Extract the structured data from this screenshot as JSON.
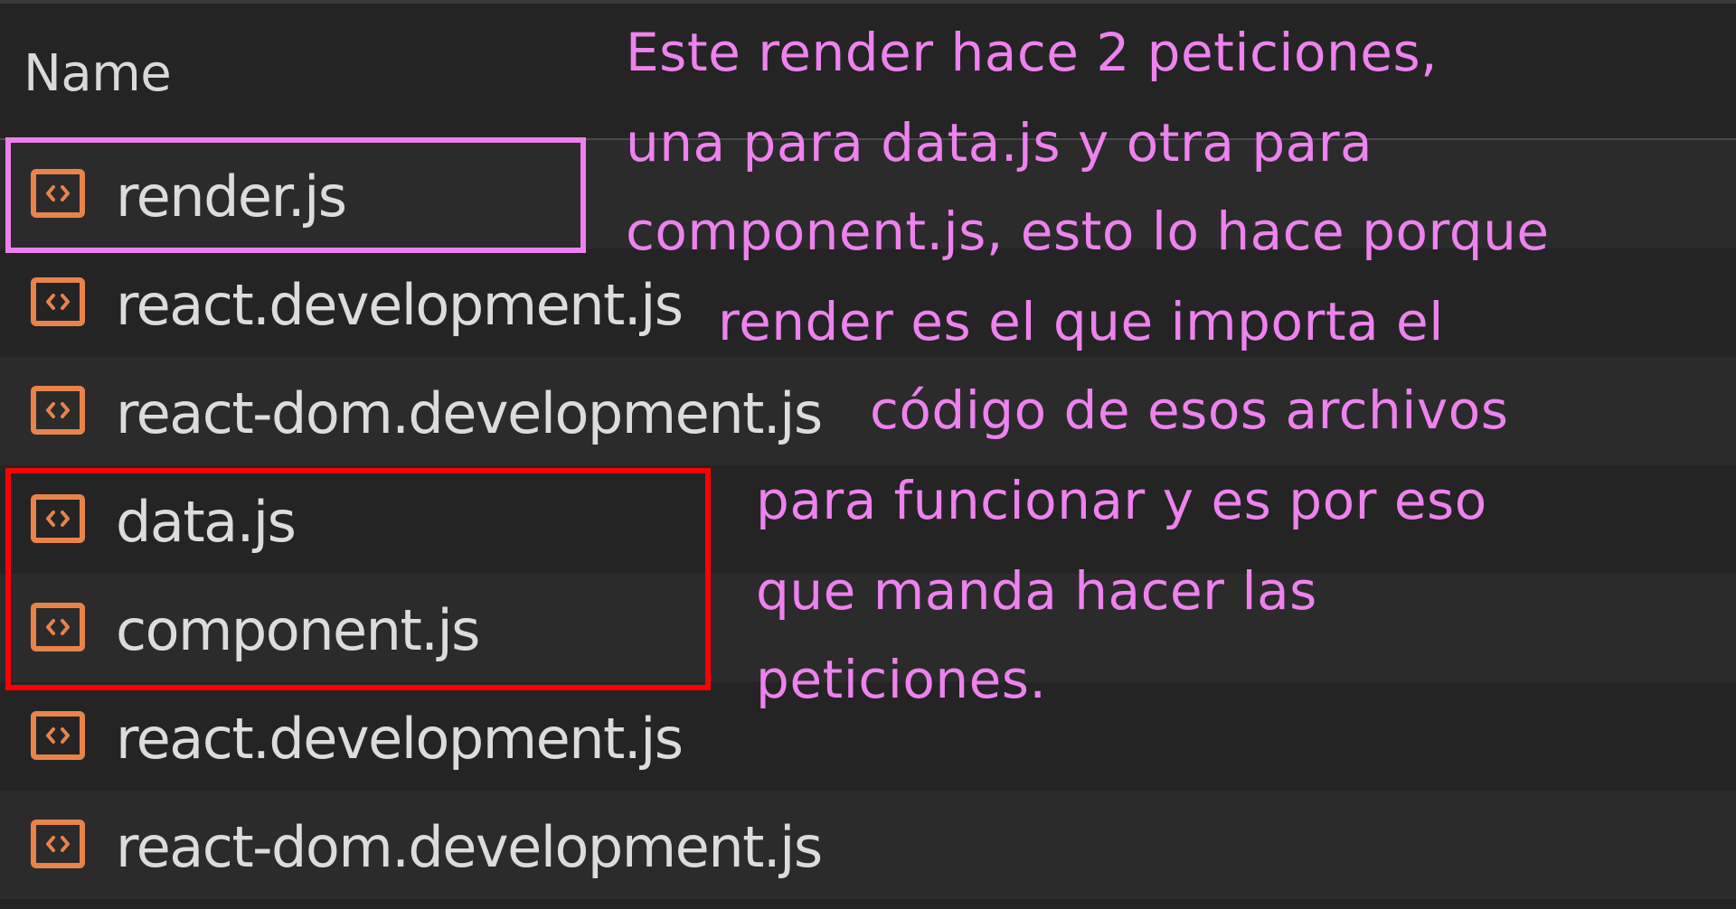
{
  "network_panel": {
    "column_header": "Name",
    "rows": [
      {
        "file": "render.js",
        "icon": "script-file-icon"
      },
      {
        "file": "react.development.js",
        "icon": "script-file-icon"
      },
      {
        "file": "react-dom.development.js",
        "icon": "script-file-icon"
      },
      {
        "file": "data.js",
        "icon": "script-file-icon"
      },
      {
        "file": "component.js",
        "icon": "script-file-icon"
      },
      {
        "file": "react.development.js",
        "icon": "script-file-icon"
      },
      {
        "file": "react-dom.development.js",
        "icon": "script-file-icon"
      }
    ]
  },
  "annotations": {
    "lines": [
      "Este render hace 2 peticiones,",
      "una para data.js y otra para",
      "component.js, esto lo hace porque",
      "render es el que importa el",
      "código de esos archivos",
      "para funcionar y es por eso",
      "que manda hacer las",
      "peticiones."
    ],
    "colors": {
      "text": "#ee82ee",
      "highlight_box": "#ef7fef",
      "requests_box": "#ff0000"
    }
  },
  "theme": {
    "background": "#242424",
    "row_alt_background": "#2b2b2b",
    "icon_color": "#e8834a",
    "text_color": "#dcdcdc"
  }
}
